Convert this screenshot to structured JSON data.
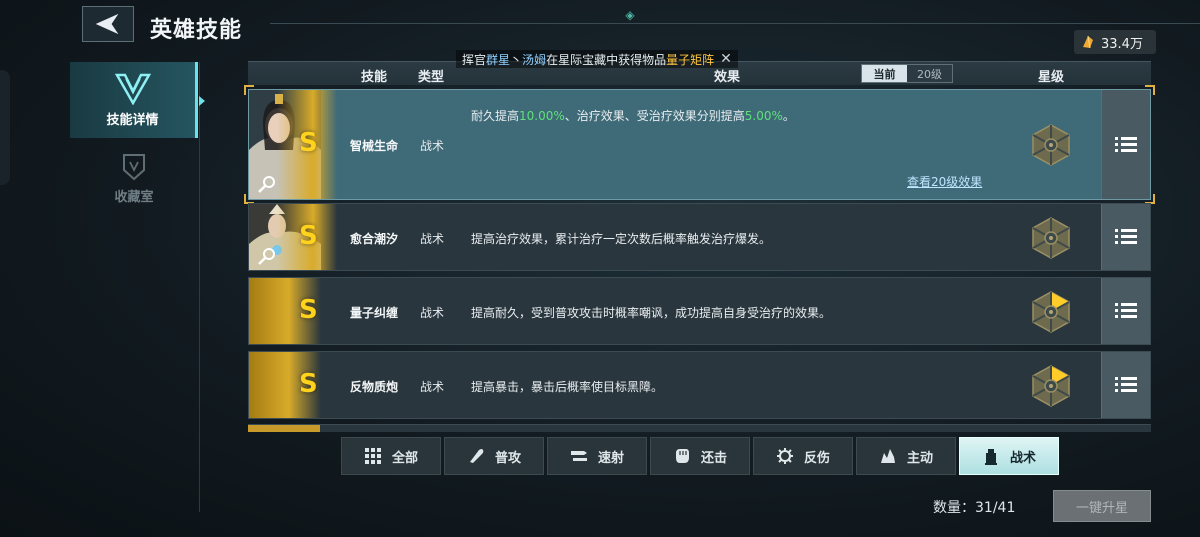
{
  "header": {
    "title": "英雄技能",
    "currency_value": "33.4万"
  },
  "sidebar": {
    "items": [
      {
        "label": "技能详情",
        "active": true
      },
      {
        "label": "收藏室",
        "active": false
      }
    ]
  },
  "notice": {
    "prefix": "挥官",
    "name1": "群星",
    "sep": "丶",
    "name2": "汤姆",
    "mid": "在星际宝藏中获得物品",
    "item": "量子矩阵"
  },
  "table": {
    "headers": {
      "skill": "技能",
      "type": "类型",
      "effect": "效果",
      "star": "星级"
    },
    "level_toggle": {
      "current": "当前",
      "level20": "20级"
    },
    "rows": [
      {
        "grade": "S",
        "name": "智械生命",
        "type": "战术",
        "effect_a": "耐久提高",
        "effect_v1": "10.00%",
        "effect_b": "、治疗效果、受治疗效果分别提高",
        "effect_v2": "5.00%",
        "effect_c": "。",
        "link": "查看20级效果",
        "star_level": 0
      },
      {
        "grade": "S",
        "name": "愈合潮汐",
        "type": "战术",
        "effect": "提高治疗效果，累计治疗一定次数后概率触发治疗爆发。",
        "star_level": 0
      },
      {
        "grade": "S",
        "name": "量子纠缠",
        "type": "战术",
        "effect": "提高耐久，受到普攻攻击时概率嘲讽，成功提高自身受治疗的效果。",
        "star_level": 1
      },
      {
        "grade": "S",
        "name": "反物质炮",
        "type": "战术",
        "effect": "提高暴击，暴击后概率使目标黑障。",
        "star_level": 1
      }
    ]
  },
  "filters": [
    {
      "label": "全部",
      "icon": "grid-icon"
    },
    {
      "label": "普攻",
      "icon": "bullet-icon"
    },
    {
      "label": "速射",
      "icon": "rapid-fire-icon"
    },
    {
      "label": "还击",
      "icon": "fist-icon"
    },
    {
      "label": "反伤",
      "icon": "gear-icon"
    },
    {
      "label": "主动",
      "icon": "flame-icon"
    },
    {
      "label": "战术",
      "icon": "tower-icon",
      "active": true
    }
  ],
  "footer": {
    "count_label": "数量：31/41",
    "upgrade_button": "一键升星"
  },
  "colors": {
    "accent": "#6de0e8",
    "grade_gold": "#ffd21c",
    "highlight_green": "#5fe07a",
    "selected_row": "#3f6a78"
  }
}
